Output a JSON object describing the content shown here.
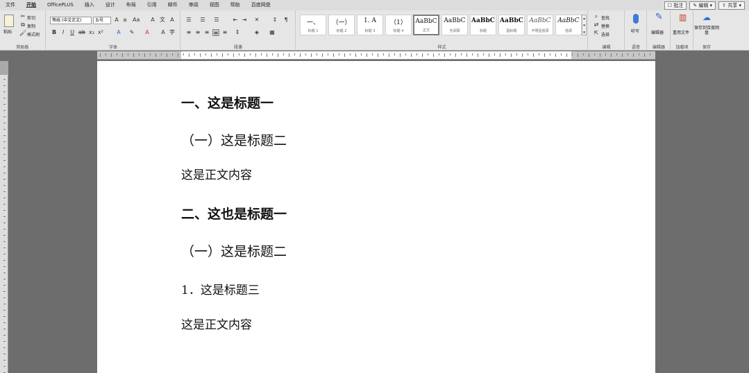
{
  "menu": {
    "tabs": [
      "文件",
      "开始",
      "OfficePLUS",
      "插入",
      "设计",
      "布局",
      "引用",
      "邮件",
      "审阅",
      "视图",
      "帮助",
      "百度网盘"
    ],
    "active_index": 1,
    "right_buttons": [
      "批注",
      "编辑",
      "共享"
    ]
  },
  "ribbon": {
    "clipboard": {
      "label": "剪贴板",
      "paste": "粘贴",
      "cut": "剪切",
      "copy": "复制",
      "format_painter": "格式刷"
    },
    "font": {
      "label": "字体",
      "font_name": "等线 (中文正文)",
      "font_size": "五号"
    },
    "paragraph": {
      "label": "段落"
    },
    "styles": {
      "label": "样式",
      "items": [
        {
          "preview": "一、",
          "name": "标题 1"
        },
        {
          "preview": "（一）",
          "name": "标题 2"
        },
        {
          "preview": "1.  A",
          "name": "标题 3"
        },
        {
          "preview": "（1）",
          "name": "标题 4"
        },
        {
          "preview": "AaBbC",
          "name": "正文"
        },
        {
          "preview": "AaBbC",
          "name": "无间隔"
        },
        {
          "preview": "AaBbC",
          "name": "标题"
        },
        {
          "preview": "AaBbC",
          "name": "副标题"
        },
        {
          "preview": "AaBbC",
          "name": "不明显强调"
        },
        {
          "preview": "AaBbC",
          "name": "强调"
        }
      ],
      "selected_index": 4
    },
    "editing": {
      "label": "编辑",
      "find": "查找",
      "replace": "替换",
      "select": "选择"
    },
    "voice": {
      "label": "语音",
      "dictate": "听写"
    },
    "editor": {
      "label": "编辑器",
      "button": "编辑器"
    },
    "reuse": {
      "label": "加载项",
      "button": "重用文件"
    },
    "save": {
      "label": "保存",
      "button": "保存到百度网盘"
    }
  },
  "document": {
    "paragraphs": [
      {
        "style": "h1",
        "text": "一、这是标题一"
      },
      {
        "style": "h2",
        "text": "（一）这是标题二"
      },
      {
        "style": "body",
        "text": "这是正文内容"
      },
      {
        "style": "h1",
        "text": "二、这也是标题一"
      },
      {
        "style": "h2",
        "text": "（一）这是标题二"
      },
      {
        "style": "h3",
        "text": "1．这是标题三"
      },
      {
        "style": "body",
        "text": "这是正文内容"
      }
    ]
  },
  "colors": {
    "page_bg": "#ffffff",
    "canvas_bg": "#6d6d6d",
    "ribbon_bg": "#e6e6e6"
  }
}
